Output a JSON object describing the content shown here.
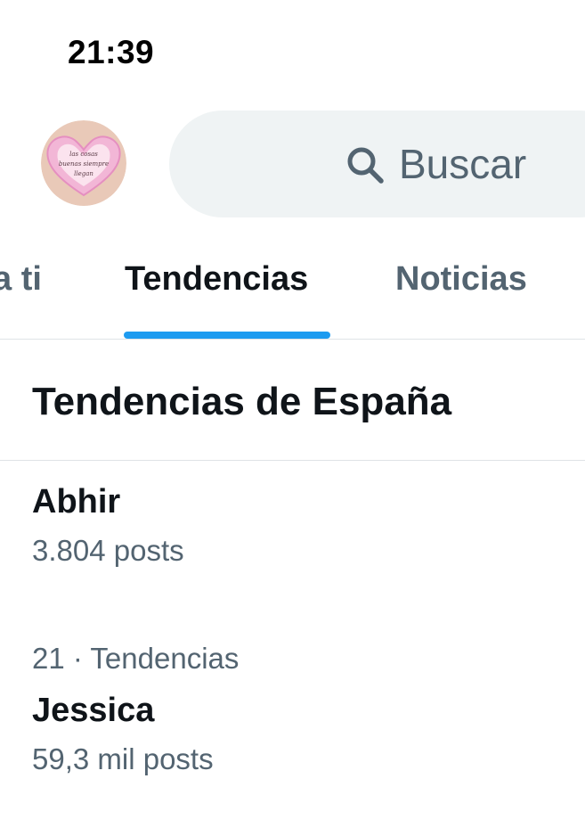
{
  "status_bar": {
    "time": "21:39"
  },
  "header": {
    "avatar_text": [
      "las cosas",
      "buenas siempre",
      "llegan"
    ],
    "search": {
      "placeholder": "Buscar"
    }
  },
  "tabs": [
    {
      "label": "Para ti",
      "visible_label": "a ti",
      "active": false
    },
    {
      "label": "Tendencias",
      "active": true
    },
    {
      "label": "Noticias",
      "active": false
    }
  ],
  "section": {
    "title": "Tendencias de España"
  },
  "trends": [
    {
      "meta": "",
      "name": "Abhir",
      "count": "3.804 posts"
    },
    {
      "meta": "21 · Tendencias",
      "name": "Jessica",
      "count": "59,3 mil posts"
    }
  ],
  "colors": {
    "accent": "#1d9bf0",
    "text_primary": "#0f1419",
    "text_secondary": "#536471",
    "search_bg": "#eff3f4",
    "avatar_bg": "#e9c9b8",
    "avatar_heart": "#f2b6d6"
  },
  "icons": {
    "search": "search-icon"
  }
}
